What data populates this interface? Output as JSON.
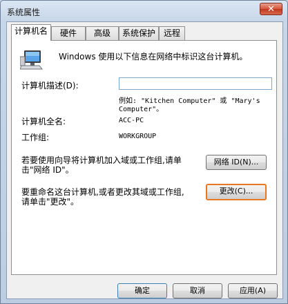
{
  "window": {
    "title": "系统属性",
    "close_glyph": "✕"
  },
  "tabs": [
    {
      "label": "计算机名",
      "active": true
    },
    {
      "label": "硬件"
    },
    {
      "label": "高级"
    },
    {
      "label": "系统保护"
    },
    {
      "label": "远程"
    }
  ],
  "panel": {
    "intro": "Windows 使用以下信息在网络中标识这台计算机。",
    "desc_label": "计算机描述(D):",
    "desc_value": "",
    "example_line1": "例如: \"Kitchen Computer\" 或 \"Mary's",
    "example_line2": "Computer\"。",
    "fullname_label": "计算机全名:",
    "fullname_value": "ACC-PC",
    "workgroup_label": "工作组:",
    "workgroup_value": "WORKGROUP",
    "netid_text_line1": "若要使用向导将计算机加入域或工作组,请单",
    "netid_text_line2": "击\"网络 ID\"。",
    "netid_button": "网络 ID(N)...",
    "rename_text_line1": "要重命名这台计算机,或者更改其域或工作组,",
    "rename_text_line2": "请单击\"更改\"。",
    "change_button": "更改(C)..."
  },
  "footer": {
    "ok": "确定",
    "cancel": "取消",
    "apply": "应用(A)"
  },
  "colors": {
    "focus_border": "#e87722",
    "close_button": "#c0381c"
  }
}
